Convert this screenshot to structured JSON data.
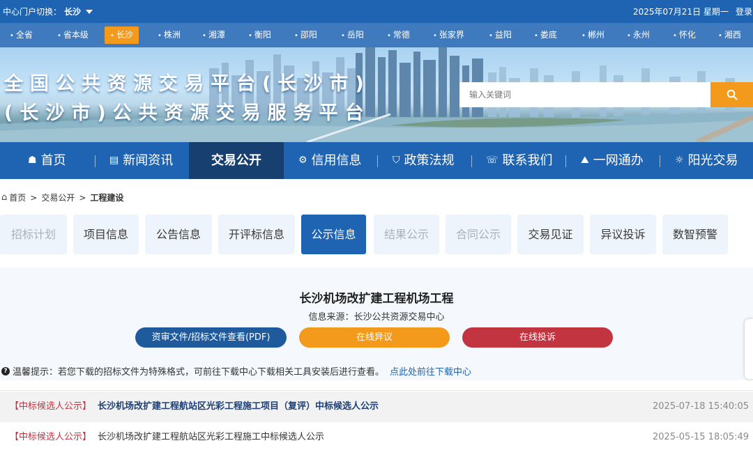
{
  "topbar": {
    "switch_label": "中心门户切换：",
    "current_center": "长沙",
    "date": "2025年07月21日 星期一",
    "login": "登录"
  },
  "cities": [
    "全省",
    "省本级",
    "长沙",
    "株洲",
    "湘潭",
    "衡阳",
    "邵阳",
    "岳阳",
    "常德",
    "张家界",
    "益阳",
    "娄底",
    "郴州",
    "永州",
    "怀化",
    "湘西"
  ],
  "active_city": "长沙",
  "banner": {
    "title_line1": "全国公共资源交易平台(长沙市)",
    "title_line2": "(长沙市)公共资源交易服务平台",
    "search_placeholder": "输入关键词"
  },
  "nav": {
    "items": [
      {
        "label": "首页",
        "icon": "home-icon"
      },
      {
        "label": "新闻资讯",
        "icon": "news-icon"
      },
      {
        "label": "交易公开",
        "icon": ""
      },
      {
        "label": "信用信息",
        "icon": "credit-icon"
      },
      {
        "label": "政策法规",
        "icon": "policy-icon"
      },
      {
        "label": "联系我们",
        "icon": "contact-icon"
      },
      {
        "label": "一网通办",
        "icon": "service-icon"
      },
      {
        "label": "阳光交易",
        "icon": "sunshine-icon"
      }
    ],
    "active": "交易公开"
  },
  "breadcrumb": {
    "home": "首页",
    "level2": "交易公开",
    "current": "工程建设",
    "separator": ">"
  },
  "categories": [
    {
      "label": "招标计划",
      "state": "disabled"
    },
    {
      "label": "项目信息",
      "state": "normal"
    },
    {
      "label": "公告信息",
      "state": "normal"
    },
    {
      "label": "开评标信息",
      "state": "normal"
    },
    {
      "label": "公示信息",
      "state": "active"
    },
    {
      "label": "结果公示",
      "state": "disabled"
    },
    {
      "label": "合同公示",
      "state": "disabled"
    },
    {
      "label": "交易见证",
      "state": "normal"
    },
    {
      "label": "异议投诉",
      "state": "normal"
    },
    {
      "label": "数智预警",
      "state": "normal"
    }
  ],
  "project": {
    "title": "长沙机场改扩建工程机场工程",
    "source": "信息来源：长沙公共资源交易中心",
    "btn_pdf": "资审文件/招标文件查看(PDF)",
    "btn_objection": "在线异议",
    "btn_complaint": "在线投诉",
    "tip": "温馨提示：若您下载的招标文件为特殊格式，可前往下载中心下载相关工具安装后进行查看。",
    "tip_link": "点此处前往下载中心"
  },
  "results": [
    {
      "tag": "【中标候选人公示】",
      "title": "长沙机场改扩建工程航站区光彩工程施工项目（复评）中标候选人公示",
      "time": "2025-07-18 15:40:05"
    },
    {
      "tag": "【中标候选人公示】",
      "title": "长沙机场改扩建工程航站区光彩工程施工中标候选人公示",
      "time": "2025-05-15 18:05:49"
    }
  ],
  "colors": {
    "primary": "#1f64b3",
    "nav_active": "#173f6f",
    "accent_orange": "#f39a1d",
    "complaint_red": "#c13440"
  }
}
